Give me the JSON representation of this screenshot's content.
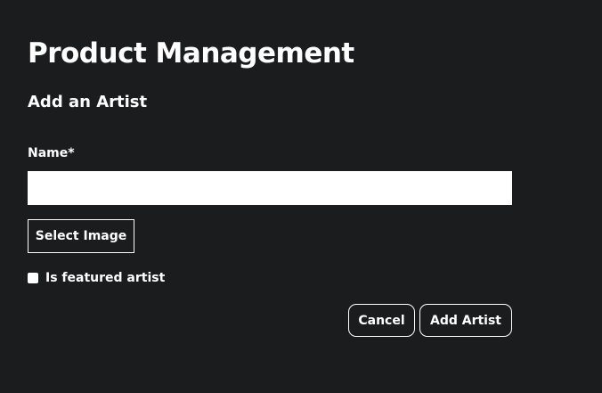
{
  "header": {
    "title": "Product Management",
    "subtitle": "Add an Artist"
  },
  "form": {
    "name_label": "Name*",
    "name_value": "",
    "name_placeholder": "",
    "select_image_label": "Select Image",
    "featured_label": "Is featured artist",
    "featured_checked": false
  },
  "actions": {
    "cancel_label": "Cancel",
    "submit_label": "Add Artist"
  },
  "colors": {
    "background": "#1b1c1e",
    "text": "#ffffff",
    "input_background": "#ffffff"
  }
}
